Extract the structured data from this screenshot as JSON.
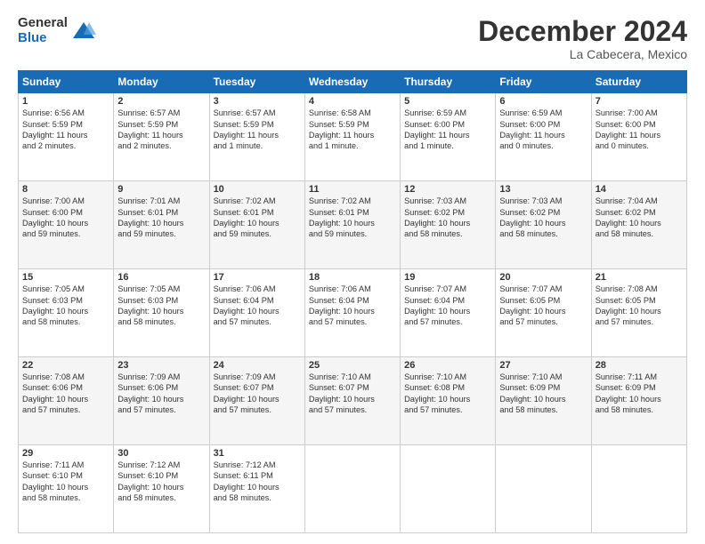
{
  "header": {
    "logo_general": "General",
    "logo_blue": "Blue",
    "month_title": "December 2024",
    "location": "La Cabecera, Mexico"
  },
  "calendar": {
    "days_of_week": [
      "Sunday",
      "Monday",
      "Tuesday",
      "Wednesday",
      "Thursday",
      "Friday",
      "Saturday"
    ],
    "rows": [
      [
        {
          "day": "1",
          "info": "Sunrise: 6:56 AM\nSunset: 5:59 PM\nDaylight: 11 hours\nand 2 minutes."
        },
        {
          "day": "2",
          "info": "Sunrise: 6:57 AM\nSunset: 5:59 PM\nDaylight: 11 hours\nand 2 minutes."
        },
        {
          "day": "3",
          "info": "Sunrise: 6:57 AM\nSunset: 5:59 PM\nDaylight: 11 hours\nand 1 minute."
        },
        {
          "day": "4",
          "info": "Sunrise: 6:58 AM\nSunset: 5:59 PM\nDaylight: 11 hours\nand 1 minute."
        },
        {
          "day": "5",
          "info": "Sunrise: 6:59 AM\nSunset: 6:00 PM\nDaylight: 11 hours\nand 1 minute."
        },
        {
          "day": "6",
          "info": "Sunrise: 6:59 AM\nSunset: 6:00 PM\nDaylight: 11 hours\nand 0 minutes."
        },
        {
          "day": "7",
          "info": "Sunrise: 7:00 AM\nSunset: 6:00 PM\nDaylight: 11 hours\nand 0 minutes."
        }
      ],
      [
        {
          "day": "8",
          "info": "Sunrise: 7:00 AM\nSunset: 6:00 PM\nDaylight: 10 hours\nand 59 minutes."
        },
        {
          "day": "9",
          "info": "Sunrise: 7:01 AM\nSunset: 6:01 PM\nDaylight: 10 hours\nand 59 minutes."
        },
        {
          "day": "10",
          "info": "Sunrise: 7:02 AM\nSunset: 6:01 PM\nDaylight: 10 hours\nand 59 minutes."
        },
        {
          "day": "11",
          "info": "Sunrise: 7:02 AM\nSunset: 6:01 PM\nDaylight: 10 hours\nand 59 minutes."
        },
        {
          "day": "12",
          "info": "Sunrise: 7:03 AM\nSunset: 6:02 PM\nDaylight: 10 hours\nand 58 minutes."
        },
        {
          "day": "13",
          "info": "Sunrise: 7:03 AM\nSunset: 6:02 PM\nDaylight: 10 hours\nand 58 minutes."
        },
        {
          "day": "14",
          "info": "Sunrise: 7:04 AM\nSunset: 6:02 PM\nDaylight: 10 hours\nand 58 minutes."
        }
      ],
      [
        {
          "day": "15",
          "info": "Sunrise: 7:05 AM\nSunset: 6:03 PM\nDaylight: 10 hours\nand 58 minutes."
        },
        {
          "day": "16",
          "info": "Sunrise: 7:05 AM\nSunset: 6:03 PM\nDaylight: 10 hours\nand 58 minutes."
        },
        {
          "day": "17",
          "info": "Sunrise: 7:06 AM\nSunset: 6:04 PM\nDaylight: 10 hours\nand 57 minutes."
        },
        {
          "day": "18",
          "info": "Sunrise: 7:06 AM\nSunset: 6:04 PM\nDaylight: 10 hours\nand 57 minutes."
        },
        {
          "day": "19",
          "info": "Sunrise: 7:07 AM\nSunset: 6:04 PM\nDaylight: 10 hours\nand 57 minutes."
        },
        {
          "day": "20",
          "info": "Sunrise: 7:07 AM\nSunset: 6:05 PM\nDaylight: 10 hours\nand 57 minutes."
        },
        {
          "day": "21",
          "info": "Sunrise: 7:08 AM\nSunset: 6:05 PM\nDaylight: 10 hours\nand 57 minutes."
        }
      ],
      [
        {
          "day": "22",
          "info": "Sunrise: 7:08 AM\nSunset: 6:06 PM\nDaylight: 10 hours\nand 57 minutes."
        },
        {
          "day": "23",
          "info": "Sunrise: 7:09 AM\nSunset: 6:06 PM\nDaylight: 10 hours\nand 57 minutes."
        },
        {
          "day": "24",
          "info": "Sunrise: 7:09 AM\nSunset: 6:07 PM\nDaylight: 10 hours\nand 57 minutes."
        },
        {
          "day": "25",
          "info": "Sunrise: 7:10 AM\nSunset: 6:07 PM\nDaylight: 10 hours\nand 57 minutes."
        },
        {
          "day": "26",
          "info": "Sunrise: 7:10 AM\nSunset: 6:08 PM\nDaylight: 10 hours\nand 57 minutes."
        },
        {
          "day": "27",
          "info": "Sunrise: 7:10 AM\nSunset: 6:09 PM\nDaylight: 10 hours\nand 58 minutes."
        },
        {
          "day": "28",
          "info": "Sunrise: 7:11 AM\nSunset: 6:09 PM\nDaylight: 10 hours\nand 58 minutes."
        }
      ],
      [
        {
          "day": "29",
          "info": "Sunrise: 7:11 AM\nSunset: 6:10 PM\nDaylight: 10 hours\nand 58 minutes."
        },
        {
          "day": "30",
          "info": "Sunrise: 7:12 AM\nSunset: 6:10 PM\nDaylight: 10 hours\nand 58 minutes."
        },
        {
          "day": "31",
          "info": "Sunrise: 7:12 AM\nSunset: 6:11 PM\nDaylight: 10 hours\nand 58 minutes."
        },
        null,
        null,
        null,
        null
      ]
    ]
  }
}
